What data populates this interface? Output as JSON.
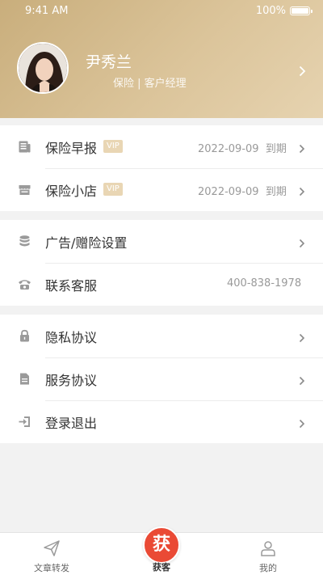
{
  "status_bar": {
    "time": "9:41 AM",
    "battery": "100%"
  },
  "profile": {
    "name": "尹秀兰",
    "role": "保险 | 客户经理"
  },
  "sections": {
    "services": [
      {
        "label": "保险早报",
        "badge": "VIP",
        "date": "2022-09-09",
        "suffix": "到期",
        "icon": "newspaper-icon"
      },
      {
        "label": "保险小店",
        "badge": "VIP",
        "date": "2022-09-09",
        "suffix": "到期",
        "icon": "store-icon"
      }
    ],
    "settings": [
      {
        "label": "广告/赠险设置",
        "icon": "database-icon"
      },
      {
        "label": "联系客服",
        "value": "400-838-1978",
        "icon": "phone-icon"
      }
    ],
    "legal": [
      {
        "label": "隐私协议",
        "icon": "lock-icon"
      },
      {
        "label": "服务协议",
        "icon": "document-icon"
      },
      {
        "label": "登录退出",
        "icon": "logout-icon"
      }
    ]
  },
  "tabbar": {
    "tabs": [
      {
        "label": "文章转发",
        "icon": "send-icon"
      },
      {
        "label": "获客",
        "badge": "获",
        "icon": "acquire-badge"
      },
      {
        "label": "我的",
        "icon": "user-icon"
      }
    ],
    "active_index": 1
  },
  "colors": {
    "header_gold": "#c9ae7c",
    "vip_badge": "#e9d6b4",
    "accent_red": "#ea4a35",
    "background": "#f2f2f2"
  }
}
